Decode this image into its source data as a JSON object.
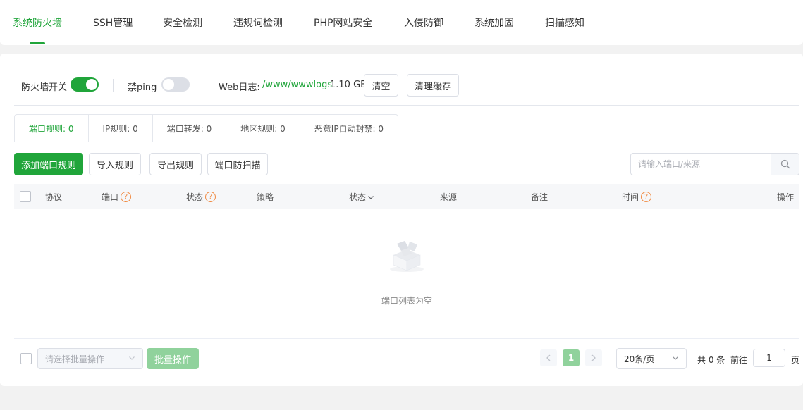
{
  "top_tabs": [
    {
      "label": "系统防火墙",
      "active": true
    },
    {
      "label": "SSH管理",
      "active": false
    },
    {
      "label": "安全检测",
      "active": false
    },
    {
      "label": "违规词检测",
      "active": false
    },
    {
      "label": "PHP网站安全",
      "active": false
    },
    {
      "label": "入侵防御",
      "active": false
    },
    {
      "label": "系统加固",
      "active": false
    },
    {
      "label": "扫描感知",
      "active": false
    }
  ],
  "toolbar": {
    "firewall_label": "防火墙开关",
    "firewall_on": true,
    "ping_label": "禁ping",
    "ping_on": false,
    "weblog_label": "Web日志:",
    "weblog_path": "/www/wwwlogs",
    "weblog_size": "1.10 GB",
    "clear_label": "清空",
    "clear_cache_label": "清理缓存"
  },
  "sub_tabs": [
    {
      "label": "端口规则: 0",
      "active": true
    },
    {
      "label": "IP规则: 0",
      "active": false
    },
    {
      "label": "端口转发: 0",
      "active": false
    },
    {
      "label": "地区规则: 0",
      "active": false
    },
    {
      "label": "恶意IP自动封禁: 0",
      "active": false
    }
  ],
  "actions": {
    "add_label": "添加端口规则",
    "import_label": "导入规则",
    "export_label": "导出规则",
    "antiscan_label": "端口防扫描"
  },
  "search": {
    "placeholder": "请输入端口/来源"
  },
  "table": {
    "columns": [
      "协议",
      "端口",
      "状态",
      "策略",
      "状态",
      "来源",
      "备注",
      "时间",
      "操作"
    ],
    "empty_text": "端口列表为空"
  },
  "footer": {
    "batch_placeholder": "请选择批量操作",
    "batch_button": "批量操作",
    "current_page": "1",
    "page_size": "20条/页",
    "total": "共 0 条",
    "goto_prefix": "前往",
    "goto_value": "1",
    "goto_suffix": "页"
  },
  "colors": {
    "accent": "#20a53a",
    "warning": "#f0883e"
  }
}
